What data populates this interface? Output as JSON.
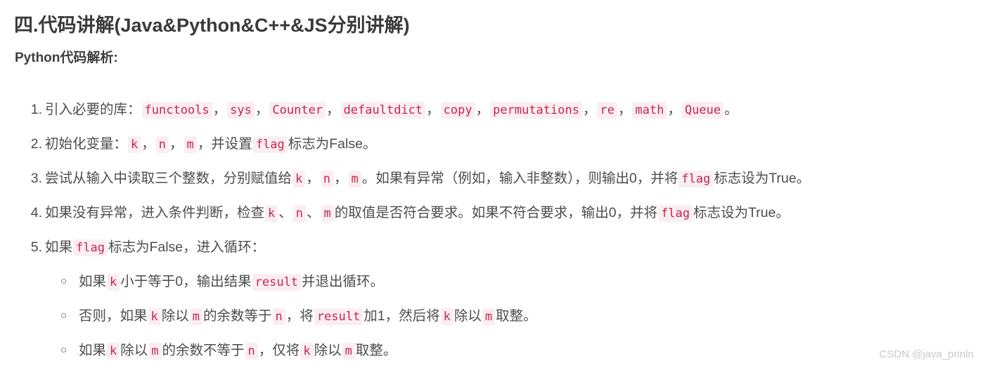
{
  "heading": "四.代码讲解(Java&Python&C++&JS分别讲解)",
  "subheading": "Python代码解析:",
  "watermark": "CSDN @java_prinln",
  "colors": {
    "heading_text": "#3a3a3a",
    "body_text": "#4d4d4d",
    "code_text": "#c7254e",
    "code_background": "#fbeef2",
    "page_background": "#ffffff",
    "watermark_text": "#c9c9c9"
  },
  "steps": [
    {
      "marker": "1.",
      "parts": [
        {
          "type": "text",
          "value": "引入必要的库："
        },
        {
          "type": "code",
          "value": "functools"
        },
        {
          "type": "text",
          "value": "，"
        },
        {
          "type": "code",
          "value": "sys"
        },
        {
          "type": "text",
          "value": "，"
        },
        {
          "type": "code",
          "value": "Counter"
        },
        {
          "type": "text",
          "value": "，"
        },
        {
          "type": "code",
          "value": "defaultdict"
        },
        {
          "type": "text",
          "value": "，"
        },
        {
          "type": "code",
          "value": "copy"
        },
        {
          "type": "text",
          "value": "，"
        },
        {
          "type": "code",
          "value": "permutations"
        },
        {
          "type": "text",
          "value": "，"
        },
        {
          "type": "code",
          "value": "re"
        },
        {
          "type": "text",
          "value": "，"
        },
        {
          "type": "code",
          "value": "math"
        },
        {
          "type": "text",
          "value": "，"
        },
        {
          "type": "code",
          "value": "Queue"
        },
        {
          "type": "text",
          "value": "。"
        }
      ],
      "substeps": []
    },
    {
      "marker": "2.",
      "parts": [
        {
          "type": "text",
          "value": "初始化变量："
        },
        {
          "type": "code",
          "value": "k"
        },
        {
          "type": "text",
          "value": "，"
        },
        {
          "type": "code",
          "value": "n"
        },
        {
          "type": "text",
          "value": "，"
        },
        {
          "type": "code",
          "value": "m"
        },
        {
          "type": "text",
          "value": "，并设置"
        },
        {
          "type": "code",
          "value": "flag"
        },
        {
          "type": "text",
          "value": "标志为False。"
        }
      ],
      "substeps": []
    },
    {
      "marker": "3.",
      "parts": [
        {
          "type": "text",
          "value": "尝试从输入中读取三个整数，分别赋值给"
        },
        {
          "type": "code",
          "value": "k"
        },
        {
          "type": "text",
          "value": "，"
        },
        {
          "type": "code",
          "value": "n"
        },
        {
          "type": "text",
          "value": "，"
        },
        {
          "type": "code",
          "value": "m"
        },
        {
          "type": "text",
          "value": "。如果有异常（例如，输入非整数），则输出0，并将"
        },
        {
          "type": "code",
          "value": "flag"
        },
        {
          "type": "text",
          "value": "标志设为True。"
        }
      ],
      "substeps": []
    },
    {
      "marker": "4.",
      "parts": [
        {
          "type": "text",
          "value": "如果没有异常，进入条件判断，检查"
        },
        {
          "type": "code",
          "value": "k"
        },
        {
          "type": "text",
          "value": "、"
        },
        {
          "type": "code",
          "value": "n"
        },
        {
          "type": "text",
          "value": "、"
        },
        {
          "type": "code",
          "value": "m"
        },
        {
          "type": "text",
          "value": "的取值是否符合要求。如果不符合要求，输出0，并将"
        },
        {
          "type": "code",
          "value": "flag"
        },
        {
          "type": "text",
          "value": "标志设为True。"
        }
      ],
      "substeps": []
    },
    {
      "marker": "5.",
      "parts": [
        {
          "type": "text",
          "value": "如果"
        },
        {
          "type": "code",
          "value": "flag"
        },
        {
          "type": "text",
          "value": "标志为False，进入循环："
        }
      ],
      "substeps": [
        {
          "bullet": "○",
          "parts": [
            {
              "type": "text",
              "value": "如果"
            },
            {
              "type": "code",
              "value": "k"
            },
            {
              "type": "text",
              "value": "小于等于0，输出结果"
            },
            {
              "type": "code",
              "value": "result"
            },
            {
              "type": "text",
              "value": "并退出循环。"
            }
          ]
        },
        {
          "bullet": "○",
          "parts": [
            {
              "type": "text",
              "value": "否则，如果"
            },
            {
              "type": "code",
              "value": "k"
            },
            {
              "type": "text",
              "value": "除以"
            },
            {
              "type": "code",
              "value": "m"
            },
            {
              "type": "text",
              "value": "的余数等于"
            },
            {
              "type": "code",
              "value": "n"
            },
            {
              "type": "text",
              "value": "，将"
            },
            {
              "type": "code",
              "value": "result"
            },
            {
              "type": "text",
              "value": "加1，然后将"
            },
            {
              "type": "code",
              "value": "k"
            },
            {
              "type": "text",
              "value": "除以"
            },
            {
              "type": "code",
              "value": "m"
            },
            {
              "type": "text",
              "value": "取整。"
            }
          ]
        },
        {
          "bullet": "○",
          "parts": [
            {
              "type": "text",
              "value": "如果"
            },
            {
              "type": "code",
              "value": "k"
            },
            {
              "type": "text",
              "value": "除以"
            },
            {
              "type": "code",
              "value": "m"
            },
            {
              "type": "text",
              "value": "的余数不等于"
            },
            {
              "type": "code",
              "value": "n"
            },
            {
              "type": "text",
              "value": "，仅将"
            },
            {
              "type": "code",
              "value": "k"
            },
            {
              "type": "text",
              "value": "除以"
            },
            {
              "type": "code",
              "value": "m"
            },
            {
              "type": "text",
              "value": "取整。"
            }
          ]
        }
      ]
    }
  ]
}
